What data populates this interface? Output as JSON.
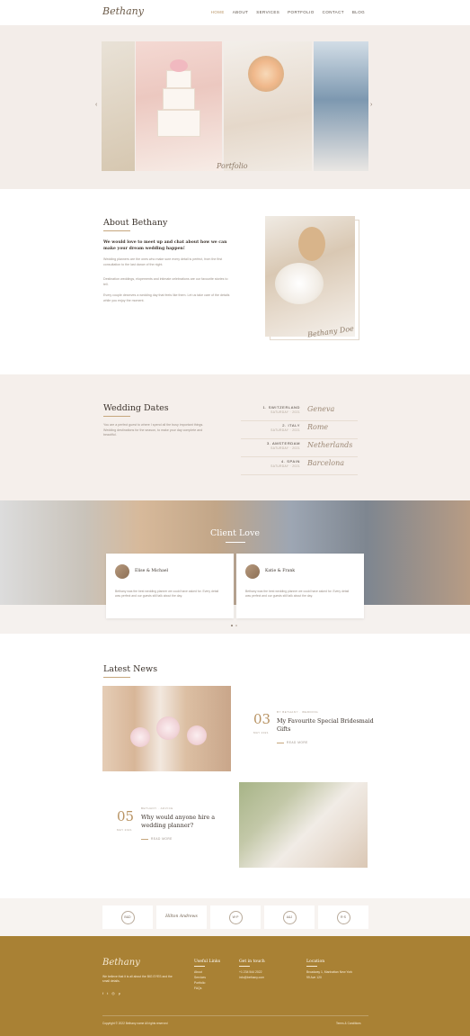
{
  "header": {
    "logo": "Bethany",
    "nav": [
      "HOME",
      "ABOUT",
      "SERVICES",
      "PORTFOLIO",
      "CONTACT",
      "BLOG"
    ],
    "active_nav": "HOME"
  },
  "hero": {
    "signature": "Portfolio",
    "prev_icon": "chevron-left-icon",
    "next_icon": "chevron-right-icon"
  },
  "about": {
    "title": "About Bethany",
    "lead": "We would love to meet up and chat about how we can make your dream wedding happen!",
    "paragraphs": [
      "Wedding planners are the ones who make sure every detail is perfect, from the first consultation to the last dance of the night.",
      "Destination weddings, elopements and intimate celebrations are our favourite stories to tell.",
      "Every couple deserves a wedding day that feels like them. Let us take care of the details while you enjoy the moment."
    ],
    "signature": "Bethany Doe"
  },
  "dates": {
    "title": "Wedding Dates",
    "text": "You are a perfect guest to where I spend all the busy important things. Wedding destinations for the season, to make your day complete and beautiful.",
    "rows": [
      {
        "place": "1. SWITZERLAND",
        "when": "SATURDAY · 2021",
        "script": "Geneva"
      },
      {
        "place": "2. ITALY",
        "when": "SATURDAY · 2021",
        "script": "Rome"
      },
      {
        "place": "3. AMSTERDAM",
        "when": "SATURDAY · 2021",
        "script": "Netherlands"
      },
      {
        "place": "4. SPAIN",
        "when": "SATURDAY · 2021",
        "script": "Barcelona"
      }
    ]
  },
  "client_love": {
    "title": "Client Love",
    "cards": [
      {
        "name": "Elise & Michael",
        "text": "Bethany was the best wedding planner we could have asked for. Every detail was perfect and our guests still talk about the day."
      },
      {
        "name": "Katie & Frank",
        "text": "Bethany was the best wedding planner we could have asked for. Every detail was perfect and our guests still talk about the day."
      }
    ]
  },
  "news": {
    "title": "Latest News",
    "posts": [
      {
        "num": "03",
        "date": "MAY 2021",
        "category": "BY BETHANY · WEDDING",
        "headline": "My Favourite Special Bridesmaid Gifts",
        "more": "READ MORE"
      },
      {
        "num": "05",
        "date": "MAY 2021",
        "category": "BETHANY · ADVICE",
        "headline": "Why would anyone hire a wedding planner?",
        "more": "READ MORE"
      }
    ]
  },
  "partners": [
    {
      "kind": "mark",
      "label": "B&D"
    },
    {
      "kind": "word",
      "label": "Hilton Andrews"
    },
    {
      "kind": "mark",
      "label": "W·P"
    },
    {
      "kind": "mark",
      "label": "A&J"
    },
    {
      "kind": "mark",
      "label": "R·S"
    }
  ],
  "footer": {
    "logo": "Bethany",
    "text": "We believe that it is all about the BIG EYES and the small details.",
    "social": [
      "f",
      "t",
      "◎",
      "p"
    ],
    "cols": [
      {
        "title": "Useful Links",
        "items": [
          "About",
          "Services",
          "Portfolio",
          "FAQs"
        ]
      },
      {
        "title": "Get in touch",
        "items": [
          "+1 234 544 2022",
          "info@bethany.com"
        ]
      },
      {
        "title": "Location",
        "items": [
          "Broadway 1, Manhattan New York",
          "99 Ave 120"
        ]
      }
    ],
    "copyright": "Copyright © 2022 Bethany name All rights reserved",
    "terms": "Terms & Conditions"
  }
}
